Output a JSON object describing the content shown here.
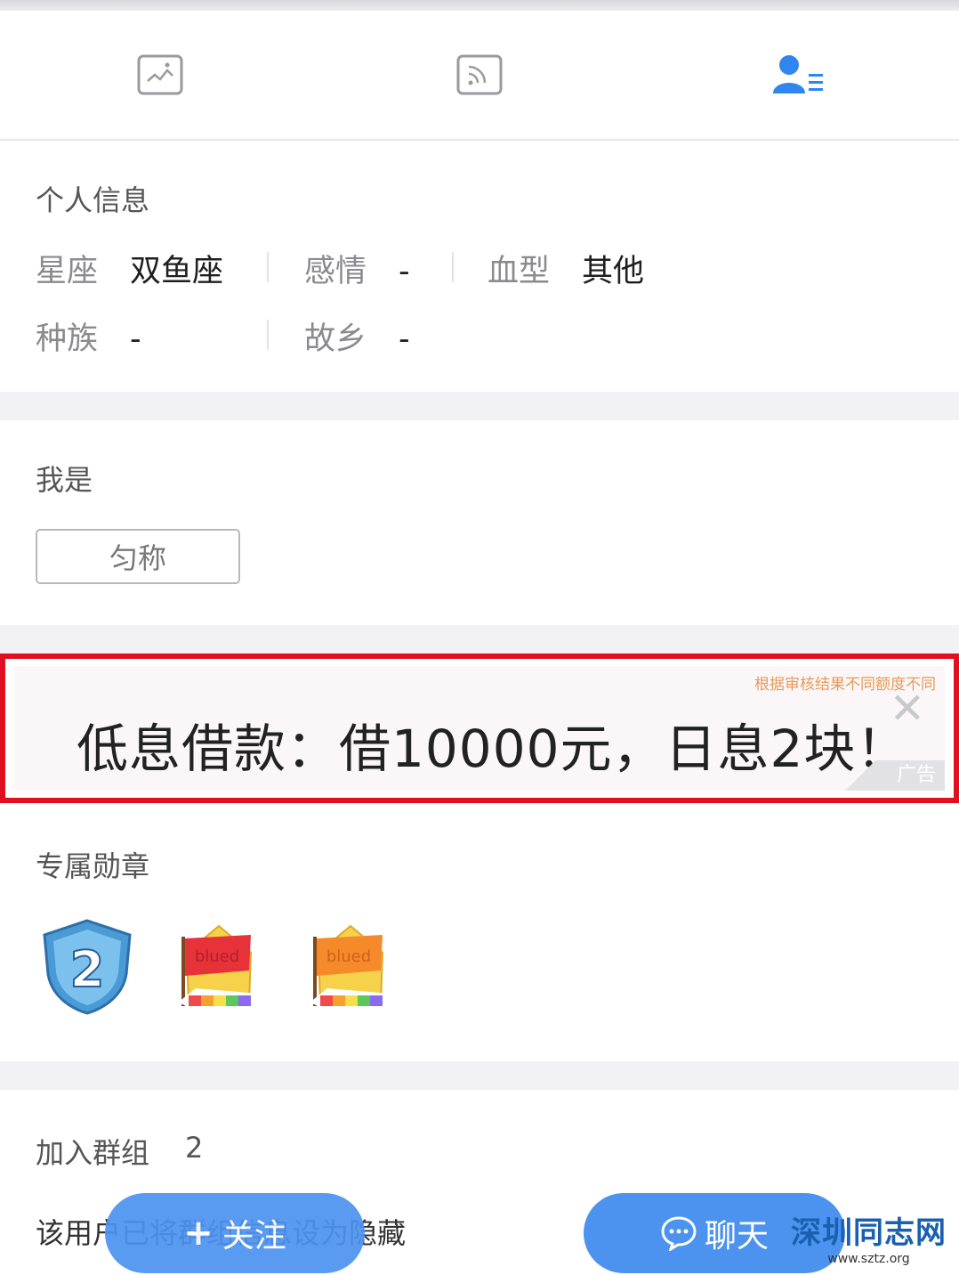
{
  "tabs": [
    {
      "icon": "image-icon",
      "active": false
    },
    {
      "icon": "feed-icon",
      "active": false
    },
    {
      "icon": "profile-icon",
      "active": true
    }
  ],
  "colors": {
    "accent": "#4c93f0",
    "ad_border": "#e01020"
  },
  "personal_info": {
    "title": "个人信息",
    "rows": [
      [
        {
          "label": "星座",
          "value": "双鱼座"
        },
        {
          "label": "感情",
          "value": "-"
        },
        {
          "label": "血型",
          "value": "其他"
        }
      ],
      [
        {
          "label": "种族",
          "value": "-"
        },
        {
          "label": "故乡",
          "value": "-"
        }
      ]
    ]
  },
  "i_am": {
    "title": "我是",
    "tag": "匀称"
  },
  "ad": {
    "note": "根据审核结果不同额度不同",
    "text": "低息借款：借10000元，日息2块！",
    "label": "广告"
  },
  "badges": {
    "title": "专属勋章",
    "items": [
      {
        "icon": "level-shield-icon",
        "text": "2"
      },
      {
        "icon": "blued-red-flag-icon",
        "text": "blued"
      },
      {
        "icon": "blued-orange-flag-icon",
        "text": "blued"
      }
    ]
  },
  "groups": {
    "title": "加入群组",
    "count": "2",
    "note": "该用户已将群组信息设为隐藏"
  },
  "actions": {
    "follow": "关注",
    "chat": "聊天"
  },
  "watermark": {
    "name": "深圳同志网",
    "url": "www.sztz.org"
  }
}
